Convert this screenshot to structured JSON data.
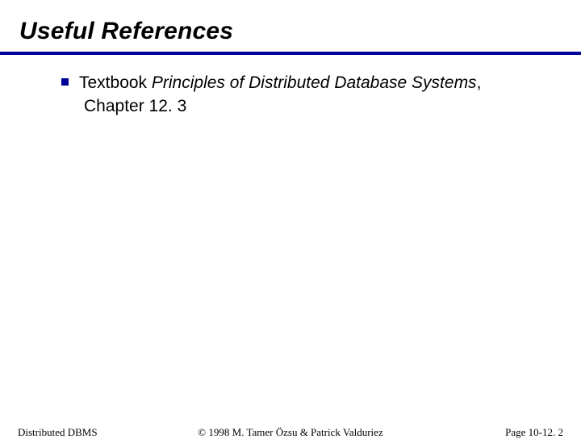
{
  "title": "Useful References",
  "bullet": {
    "prefix": "Textbook ",
    "italic": "Principles of Distributed Database Systems",
    "suffix": ",",
    "line2": "Chapter 12. 3"
  },
  "footer": {
    "left": "Distributed DBMS",
    "center": "© 1998 M. Tamer Özsu & Patrick Valduriez",
    "right": "Page 10-12. 2"
  }
}
